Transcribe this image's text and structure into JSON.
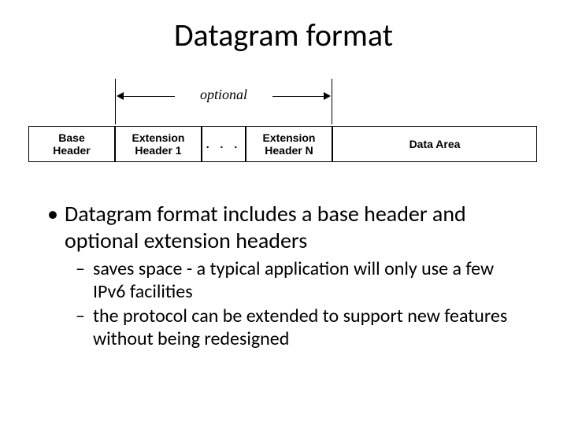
{
  "title": "Datagram format",
  "diagram": {
    "optional_label": "optional",
    "base": {
      "line1": "Base",
      "line2": "Header"
    },
    "ext1": {
      "line1": "Extension",
      "line2": "Header 1"
    },
    "dots": ". . .",
    "extn": {
      "line1": "Extension",
      "line2": "Header N"
    },
    "data": "Data Area"
  },
  "bullets": {
    "b1": "Datagram format includes a base header and optional extension headers",
    "s1": "saves space - a typical application will only use a few IPv6 facilities",
    "s2": "the protocol can be extended to support new features without being redesigned"
  }
}
